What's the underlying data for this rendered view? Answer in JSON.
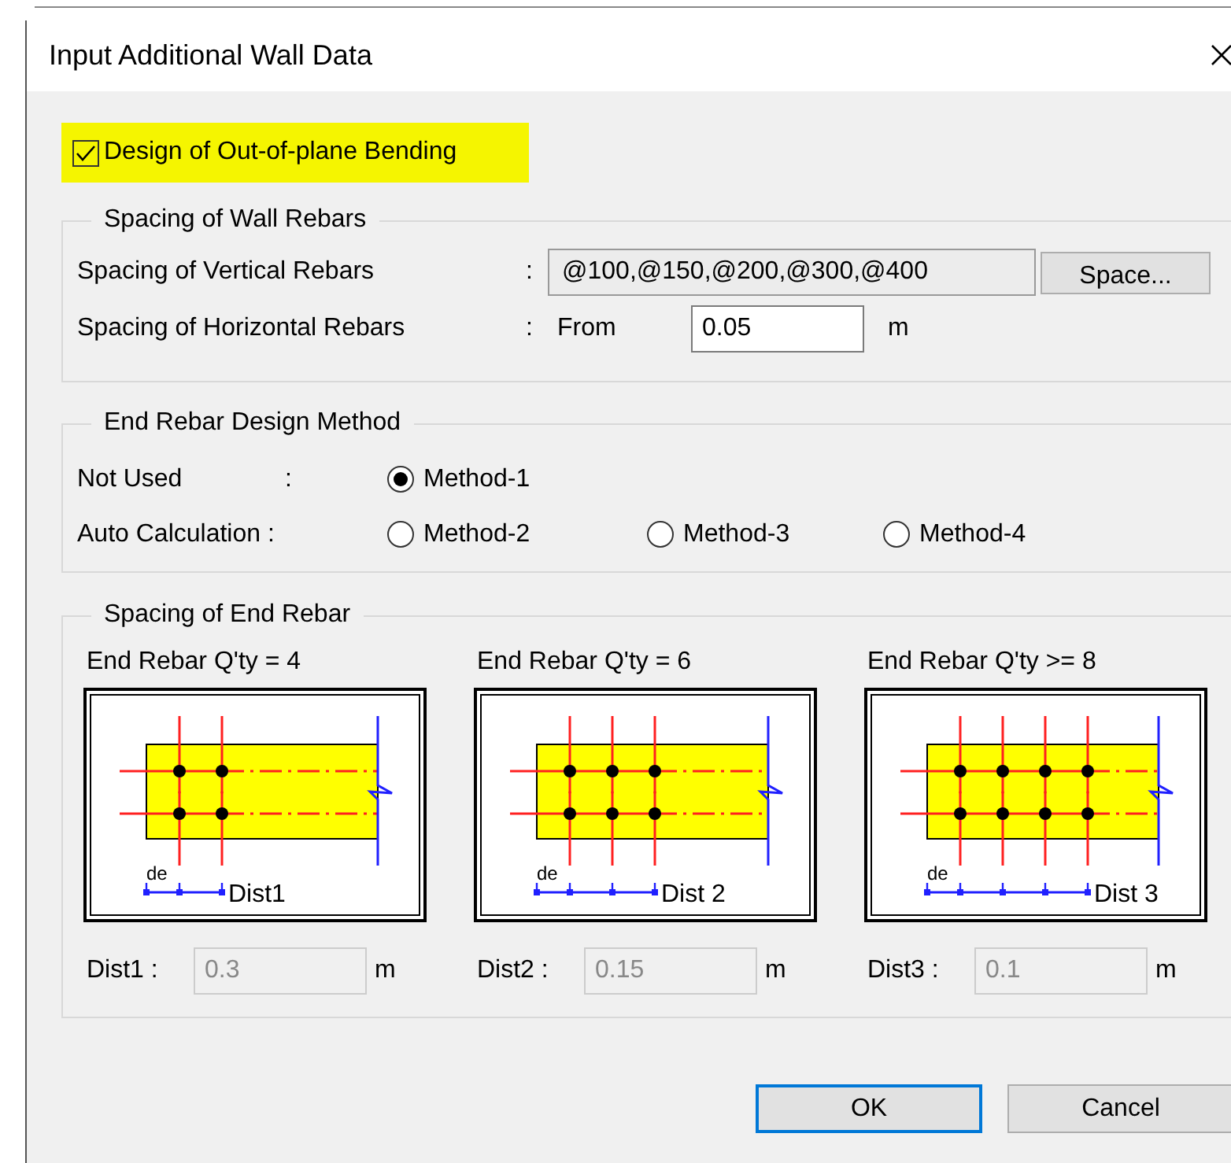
{
  "window": {
    "title": "Input Additional Wall Data"
  },
  "out_of_plane": {
    "label": "Design of Out-of-plane Bending",
    "checked": true,
    "highlighted": true
  },
  "wall_rebars": {
    "title": "Spacing of Wall Rebars",
    "vertical": {
      "label": "Spacing of Vertical Rebars",
      "colon": ":",
      "value": "@100,@150,@200,@300,@400",
      "button": "Space..."
    },
    "horizontal": {
      "label": "Spacing of Horizontal Rebars",
      "colon": ":",
      "prefix": "From",
      "value": "0.05",
      "unit": "m"
    }
  },
  "end_rebar_method": {
    "title": "End Rebar Design Method",
    "rows": [
      {
        "label": "Not Used",
        "colon": ":",
        "options": [
          {
            "label": "Method-1",
            "selected": true
          }
        ]
      },
      {
        "label": "Auto Calculation :",
        "options": [
          {
            "label": "Method-2",
            "selected": false
          },
          {
            "label": "Method-3",
            "selected": false
          },
          {
            "label": "Method-4",
            "selected": false
          }
        ]
      }
    ]
  },
  "end_rebar_spacing": {
    "title": "Spacing of End Rebar",
    "panels": [
      {
        "title": "End Rebar Q'ty = 4",
        "kind": "pair",
        "de_label": "de",
        "dist_label": "Dist1",
        "field_label": "Dist1 :",
        "value": "0.3",
        "unit": "m",
        "disabled": true
      },
      {
        "title": "End Rebar Q'ty = 6",
        "kind": "triple",
        "de_label": "de",
        "dist_label": "Dist 2",
        "field_label": "Dist2 :",
        "value": "0.15",
        "unit": "m",
        "disabled": true
      },
      {
        "title": "End Rebar Q'ty >= 8",
        "kind": "quad",
        "de_label": "de",
        "dist_label": "Dist 3",
        "field_label": "Dist3 :",
        "value": "0.1",
        "unit": "m",
        "disabled": true
      }
    ]
  },
  "buttons": [
    {
      "label": "OK",
      "default": true
    },
    {
      "label": "Cancel",
      "default": false
    }
  ]
}
